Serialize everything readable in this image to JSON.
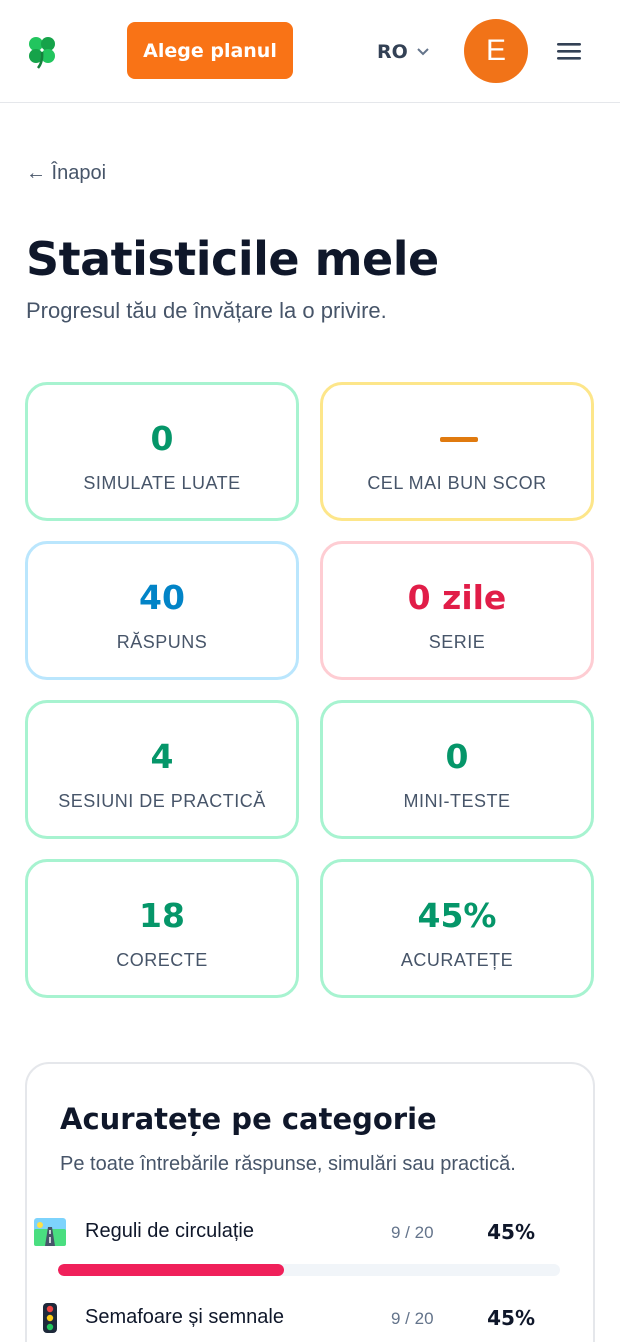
{
  "header": {
    "logo_icon": "four-leaf-clover-icon",
    "plan_button_label": "Alege planul",
    "language": "RO",
    "avatar_letter": "E",
    "menu_icon": "hamburger-menu-icon",
    "accent_color": "#f97316"
  },
  "nav": {
    "back_label": "← Înapoi"
  },
  "page": {
    "title": "Statisticile mele",
    "subtitle": "Progresul tău de învățare la o privire."
  },
  "stats": [
    {
      "value": "0",
      "label": "SIMULATE LUATE",
      "color": "#059669",
      "border": "#a7f3d0"
    },
    {
      "value": "—",
      "label": "CEL MAI BUN SCOR",
      "color": "#d97706",
      "border": "#fde68a"
    },
    {
      "value": "40",
      "label": "RĂSPUNS",
      "color": "#0284c7",
      "border": "#bae6fd"
    },
    {
      "value": "0 zile",
      "label": "SERIE",
      "color": "#e11d48",
      "border": "#fecdd3"
    },
    {
      "value": "4",
      "label": "SESIUNI DE PRACTICĂ",
      "color": "#059669",
      "border": "#a7f3d0"
    },
    {
      "value": "0",
      "label": "MINI-TESTE",
      "color": "#059669",
      "border": "#a7f3d0"
    },
    {
      "value": "18",
      "label": "CORECTE",
      "color": "#059669",
      "border": "#a7f3d0"
    },
    {
      "value": "45%",
      "label": "ACURATEȚE",
      "color": "#059669",
      "border": "#a7f3d0"
    }
  ],
  "category_panel": {
    "title": "Acuratețe pe categorie",
    "subtitle": "Pe toate întrebările răspunse, simulări sau practică.",
    "categories": [
      {
        "icon": "road-icon",
        "name": "Reguli de circulație",
        "count": "9 / 20",
        "percent": "45%",
        "fraction": 0.45,
        "bar_color": "#f0205a"
      },
      {
        "icon": "traffic-light-icon",
        "name": "Semafoare și semnale",
        "count": "9 / 20",
        "percent": "45%",
        "fraction": 0.45,
        "bar_color": "#f0205a"
      }
    ]
  }
}
